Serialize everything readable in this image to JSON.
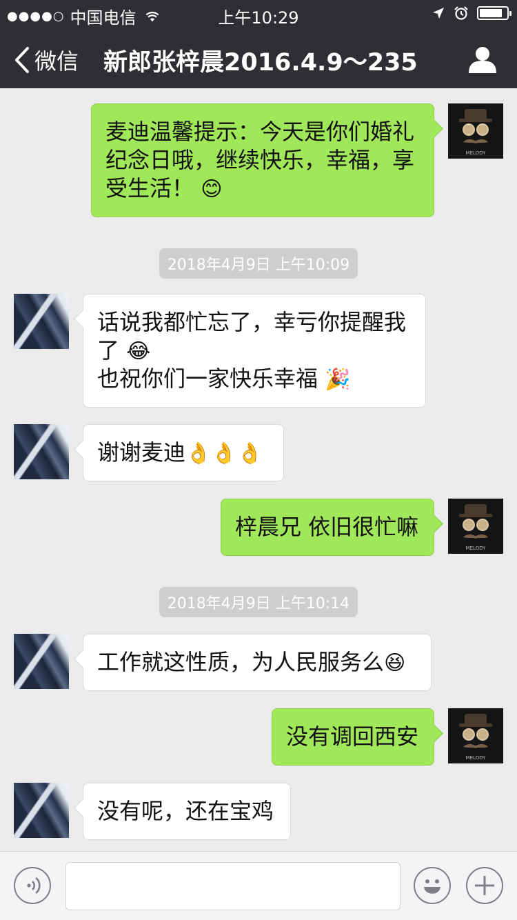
{
  "status_bar": {
    "signal": "●●●●○",
    "carrier": "中国电信",
    "time": "上午10:29",
    "battery_percent": 85
  },
  "nav": {
    "back_label": "微信",
    "title": "新郎张梓晨2016.4.9～235"
  },
  "messages": [
    {
      "side": "right",
      "text": "麦迪温馨提示：今天是你们婚礼纪念日哦，继续快乐，幸福，享受生活！",
      "emoji": "😊"
    },
    {
      "timestamp": "2018年4月9日 上午10:09"
    },
    {
      "side": "left",
      "line1": "话说我都忙忘了，幸亏你提醒我了",
      "emoji1": "😂",
      "line2": "也祝你们一家快乐幸福",
      "emoji2": "🎉"
    },
    {
      "side": "left",
      "text": "谢谢麦迪",
      "emoji": "👌👌👌"
    },
    {
      "side": "right",
      "text": "梓晨兄 依旧很忙嘛"
    },
    {
      "timestamp": "2018年4月9日 上午10:14"
    },
    {
      "side": "left",
      "text": "工作就这性质，为人民服务么",
      "emoji": "😆"
    },
    {
      "side": "right",
      "text": "没有调回西安"
    },
    {
      "side": "left",
      "text": "没有呢，还在宝鸡"
    }
  ],
  "avatars": {
    "right_caption": "MELODY"
  },
  "input_bar": {
    "placeholder": ""
  },
  "colors": {
    "nav_bg": "#2e2e33",
    "chat_bg": "#ebebeb",
    "outgoing_bubble": "#a0e75a",
    "incoming_bubble": "#ffffff",
    "timestamp_bg": "#cecece"
  }
}
